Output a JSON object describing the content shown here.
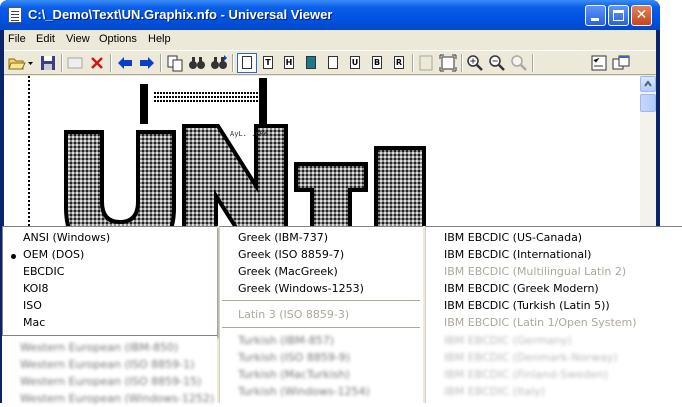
{
  "window": {
    "title": "C:\\_Demo\\Text\\UN.Graphix.nfo - Universal Viewer",
    "controls": {
      "minimize": "minimize",
      "maximize": "maximize",
      "close": "✕"
    }
  },
  "menubar": {
    "items": [
      "File",
      "Edit",
      "View",
      "Options",
      "Help"
    ]
  },
  "toolbar": {
    "view_letters": [
      "",
      "T",
      "H",
      "",
      "",
      "U",
      "B",
      "R"
    ]
  },
  "viewer": {
    "art_text": "AyL.\n.cRe"
  },
  "encoding_menu": {
    "column1": {
      "items": [
        {
          "label": "ANSI (Windows)",
          "checked": false
        },
        {
          "label": "OEM (DOS)",
          "checked": true
        },
        {
          "label": "EBCDIC",
          "checked": false
        },
        {
          "label": "KOI8",
          "checked": false
        },
        {
          "label": "ISO",
          "checked": false
        },
        {
          "label": "Mac",
          "checked": false
        }
      ],
      "blurred_items": [
        "Western European (IBM-850)",
        "Western European (ISO 8859-1)",
        "Western European (ISO 8859-15)",
        "Western European (Windows-1252)"
      ]
    },
    "column2": {
      "items": [
        "Greek (IBM-737)",
        "Greek (ISO 8859-7)",
        "Greek (MacGreek)",
        "Greek (Windows-1253)"
      ],
      "disabled_items": [
        "Latin 3 (ISO 8859-3)"
      ],
      "blurred_items": [
        "Turkish (IBM-857)",
        "Turkish (ISO 8859-9)",
        "Turkish (MacTurkish)",
        "Turkish (Windows-1254)"
      ]
    },
    "column3": {
      "items": [
        {
          "label": "IBM EBCDIC (US-Canada)",
          "enabled": true
        },
        {
          "label": "IBM EBCDIC (International)",
          "enabled": true
        },
        {
          "label": "IBM EBCDIC (Multilingual Latin 2)",
          "enabled": false
        },
        {
          "label": "IBM EBCDIC (Greek Modern)",
          "enabled": true
        },
        {
          "label": "IBM EBCDIC (Turkish (Latin 5))",
          "enabled": true
        },
        {
          "label": "IBM EBCDIC (Latin 1/Open System)",
          "enabled": false
        }
      ],
      "blurred_items": [
        "IBM EBCDIC (Germany)",
        "IBM EBCDIC (Denmark-Norway)",
        "IBM EBCDIC (Finland-Sweden)",
        "IBM EBCDIC (Italy)"
      ]
    }
  },
  "colors": {
    "titlebar": "#0054e3",
    "menu_disabled": "#aca899",
    "toolbar_blue_arrow": "#0a3fc8",
    "toolbar_red_x": "#d01818"
  }
}
